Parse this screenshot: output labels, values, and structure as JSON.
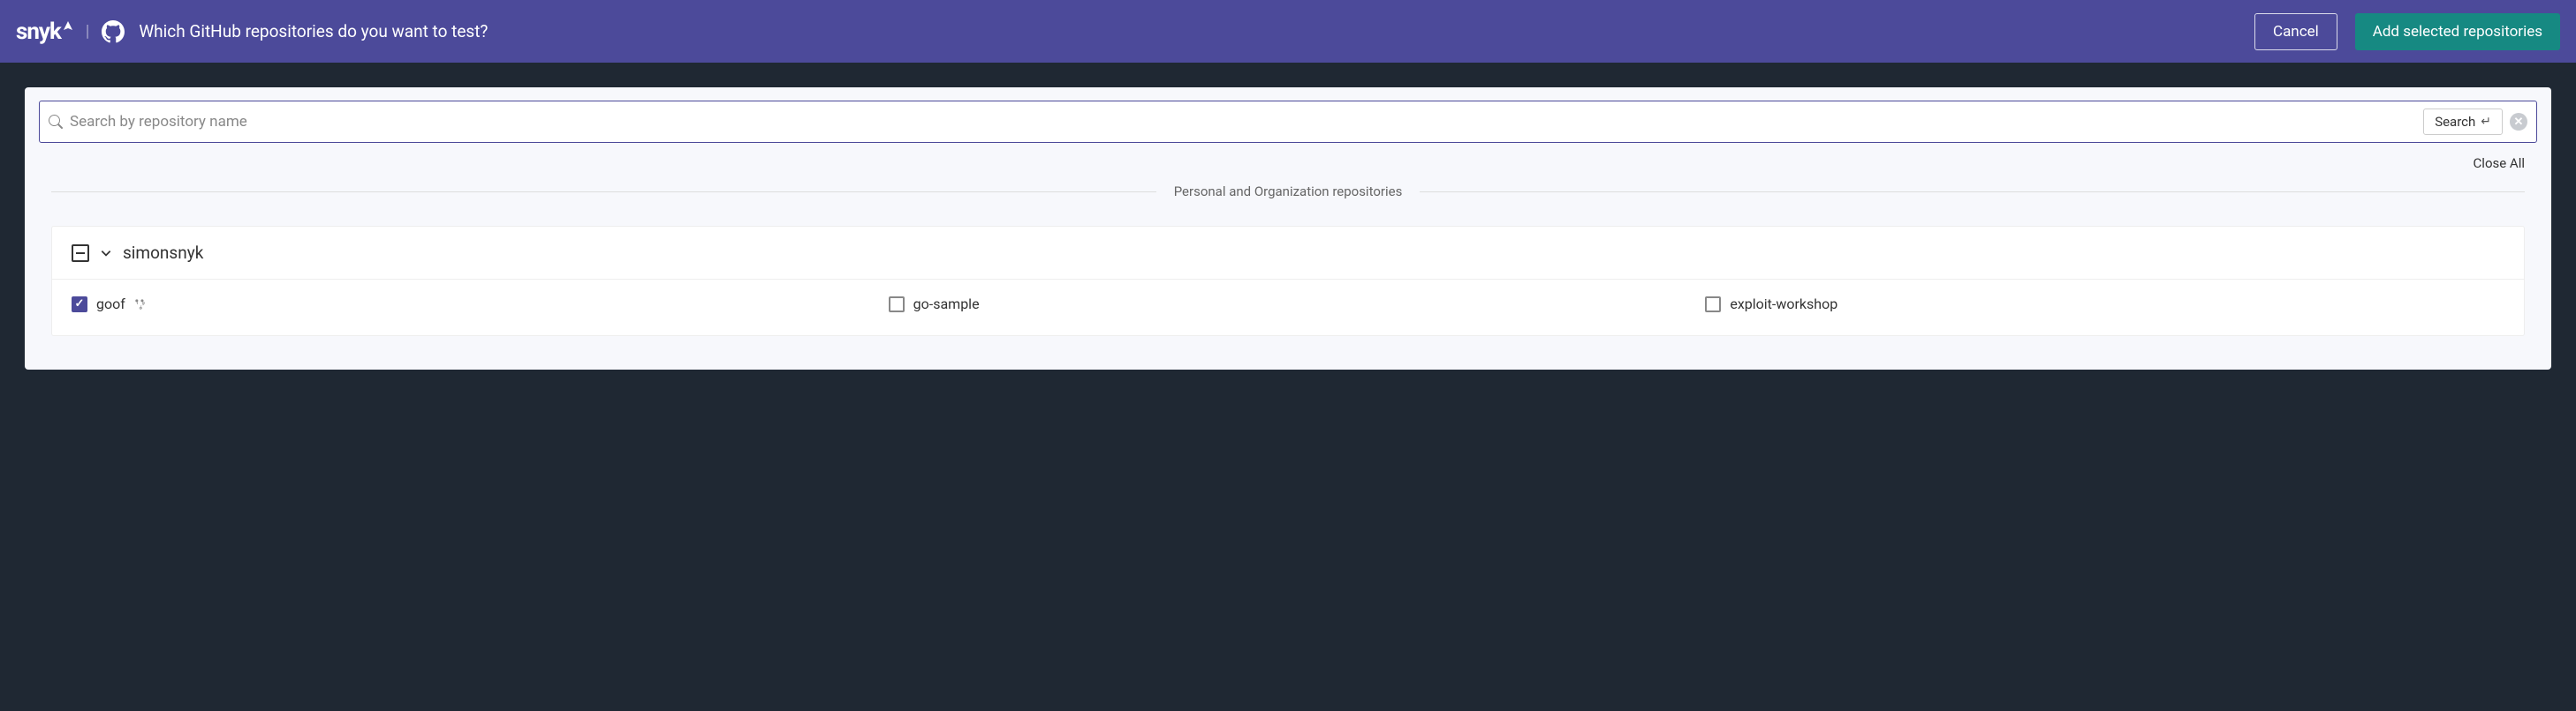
{
  "header": {
    "logo_text": "snyk",
    "title": "Which GitHub repositories do you want to test?",
    "cancel_label": "Cancel",
    "add_label": "Add selected repositories"
  },
  "search": {
    "placeholder": "Search by repository name",
    "button_label": "Search"
  },
  "actions": {
    "close_all": "Close All"
  },
  "section": {
    "label": "Personal and Organization repositories"
  },
  "org": {
    "name": "simonsnyk",
    "expanded": true,
    "checkbox_state": "indeterminate",
    "repos": [
      {
        "name": "goof",
        "checked": true,
        "fork": true
      },
      {
        "name": "go-sample",
        "checked": false,
        "fork": false
      },
      {
        "name": "exploit-workshop",
        "checked": false,
        "fork": false
      }
    ]
  }
}
